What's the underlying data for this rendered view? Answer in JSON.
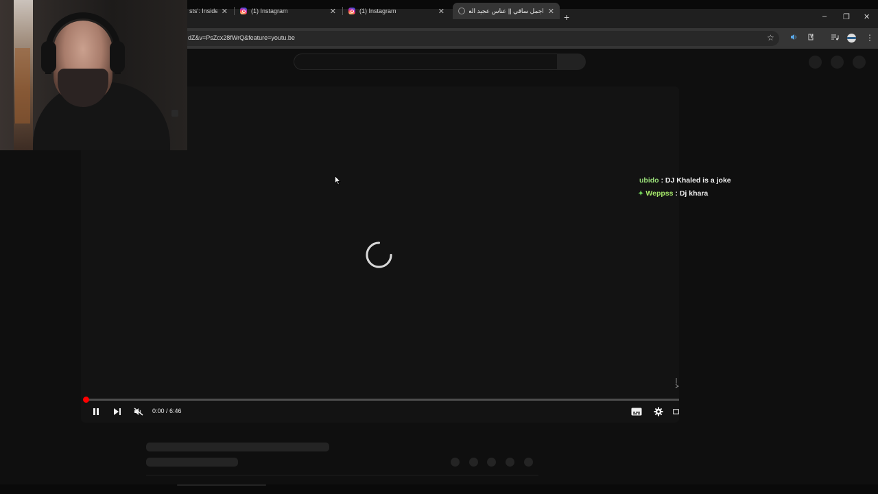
{
  "browser": {
    "tabs": [
      {
        "label": "sts': Inside th",
        "favicon": "youtube-favicon",
        "active": false
      },
      {
        "label": "(1) Instagram",
        "favicon": "instagram-favicon",
        "active": false
      },
      {
        "label": "(1) Instagram",
        "favicon": "instagram-favicon",
        "active": false
      },
      {
        "label": "اجمل ساقي || عناس عجيد العامري",
        "favicon": "youtube-favicon",
        "active": true
      }
    ],
    "new_tab_symbol": "+",
    "window_controls": {
      "minimize": "–",
      "restore": "❐",
      "close": "✕"
    },
    "url": "dZ&v=PsZcx28fWrQ&feature=youtu.be",
    "toolbar_icons": [
      "star-icon",
      "read-aloud-icon",
      "extensions-icon",
      "media-icon",
      "profile-icon",
      "kebab-menu-icon"
    ]
  },
  "player": {
    "time_current": "0:00",
    "time_separator": " / ",
    "time_total": "6:46",
    "time_display": "0:00 / 6:46",
    "progress": 0.0,
    "state": "loading",
    "muted": true,
    "accent_color": "#ff0000"
  },
  "chat": [
    {
      "user": "ubido",
      "separator": " : ",
      "message": "DJ Khaled is a joke",
      "badge": false
    },
    {
      "user": "Weppss",
      "separator": " : ",
      "message": "Dj khara",
      "badge": true
    }
  ],
  "colors": {
    "background": "#0f0f0f",
    "chat_user": "#9be07a",
    "progress": "#ff0000"
  }
}
